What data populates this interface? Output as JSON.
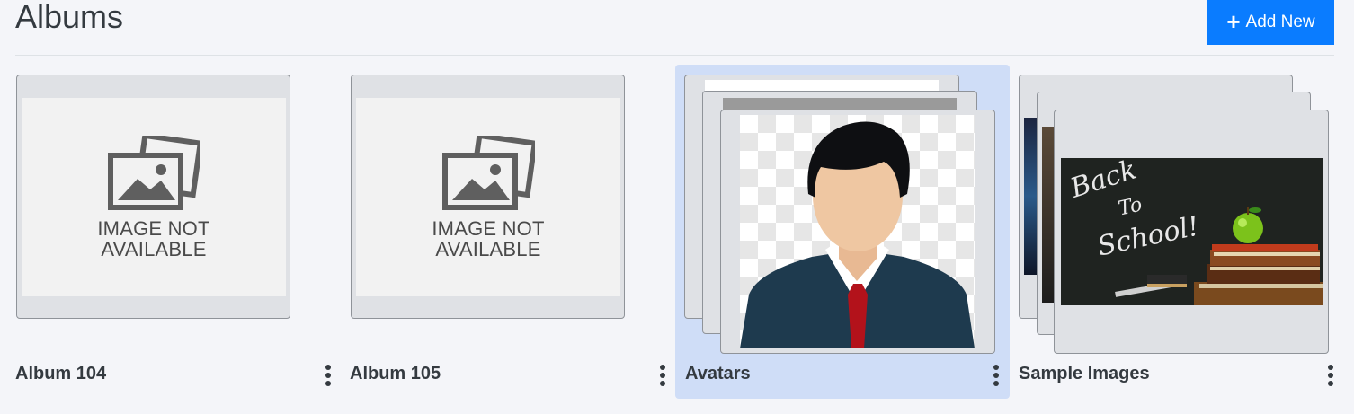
{
  "header": {
    "title": "Albums",
    "add_button_label": "Add New"
  },
  "placeholder": {
    "line1": "IMAGE NOT",
    "line2": "AVAILABLE"
  },
  "albums": [
    {
      "name": "Album 104"
    },
    {
      "name": "Album 105"
    },
    {
      "name": "Avatars"
    },
    {
      "name": "Sample Images"
    }
  ],
  "sample_image_text": {
    "line1": "Back",
    "line2": "To",
    "line3": "School!"
  },
  "colors": {
    "accent": "#0a7cff",
    "selected_bg": "#cfddf7",
    "page_bg": "#f4f5f9"
  }
}
